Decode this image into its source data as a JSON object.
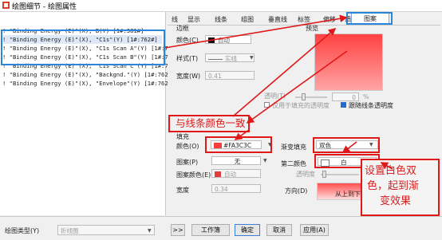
{
  "window": {
    "title": "绘图细节 - 绘图属性"
  },
  "tree": {
    "rows": [
      "! \"Binding Energy (E)\"(X), B(Y) [1#:381#]",
      "! \"Binding Energy (E)\"(X), \"C1s\"(Y) [1#:762#]",
      "! \"Binding Energy (E)\"(X), \"C1s Scan A\"(Y) [1#:762#]",
      "! \"Binding Energy (E)\"(X), \"C1s Scan B\"(Y) [1#:762#]",
      "! \"Binding Energy (E)\"(X), \"C1s Scan C\"(Y) [1#:762#]",
      "! \"Binding Energy (E)\"(X), \"Backgnd.\"(Y) [1#:762#]",
      "! \"Binding Energy (E)\"(X), \"Envelope\"(Y) [1#:762#]"
    ],
    "selected_index": 1
  },
  "tabs": [
    "线",
    "显示",
    "线条",
    "组图",
    "垂直线",
    "标签",
    "偏移",
    "质心(Pro)",
    "图案"
  ],
  "active_tab": "图案",
  "border": {
    "section": "边框",
    "color_label": "颜色(C)",
    "color_value": "自动",
    "style_label": "样式(T)",
    "style_value": "实线",
    "width_label": "宽度(W)",
    "width_value": "0.41",
    "preview_label": "预览"
  },
  "transparency": {
    "label": "透明(T)",
    "value": "0",
    "unit": "%",
    "check1_label": "仅用于填充的透明度",
    "check2_label": "跟随线条透明度"
  },
  "fill": {
    "section": "填充",
    "color_label": "颜色(O)",
    "color_value": "#FA3C3C",
    "color_hex": "#FA3C3C",
    "gradient_label": "渐变填充",
    "gradient_value": "双色",
    "pattern_label": "图案(P)",
    "pattern_value": "无",
    "pattern_color_label": "图案颜色(E)",
    "pattern_color_value": "自动",
    "second_color_label": "第二颜色",
    "second_color_value": "白",
    "opacity_label": "透明度",
    "opacity_value": "0",
    "auto_label": "自动",
    "width_label": "宽度",
    "width_value": "0.34",
    "direction_label": "方向(D)",
    "direction_value": "从上到下"
  },
  "annotations": {
    "line_color": "与线条颜色一致",
    "gradient_note": [
      "设置白色双",
      "色，起到渐",
      "变效果"
    ]
  },
  "footer": {
    "plot_type_label": "绘图类型(Y)",
    "plot_type_value": "折线图",
    "expand_button": ">>",
    "workbook_button": "工作簿",
    "ok_button": "确定",
    "cancel_button": "取消",
    "apply_button": "应用(A)"
  },
  "colors": {
    "accent_blue": "#2a86d8",
    "annotation_red": "#d81e1e",
    "fill_red": "#FA3C3C"
  }
}
